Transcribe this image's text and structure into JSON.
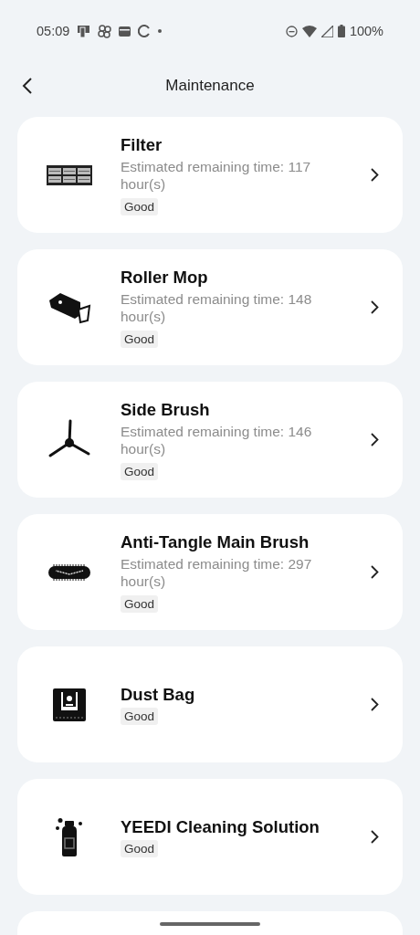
{
  "status_bar": {
    "time": "05:09",
    "battery": "100%"
  },
  "header": {
    "title": "Maintenance"
  },
  "items": [
    {
      "name": "Filter",
      "detail": "Estimated remaining time: 117 hour(s)",
      "status": "Good"
    },
    {
      "name": "Roller Mop",
      "detail": "Estimated remaining time: 148 hour(s)",
      "status": "Good"
    },
    {
      "name": "Side Brush",
      "detail": "Estimated remaining time: 146 hour(s)",
      "status": "Good"
    },
    {
      "name": "Anti-Tangle Main Brush",
      "detail": "Estimated remaining time: 297 hour(s)",
      "status": "Good"
    },
    {
      "name": "Dust Bag",
      "status": "Good"
    },
    {
      "name": "YEEDI Cleaning Solution",
      "status": "Good"
    }
  ]
}
